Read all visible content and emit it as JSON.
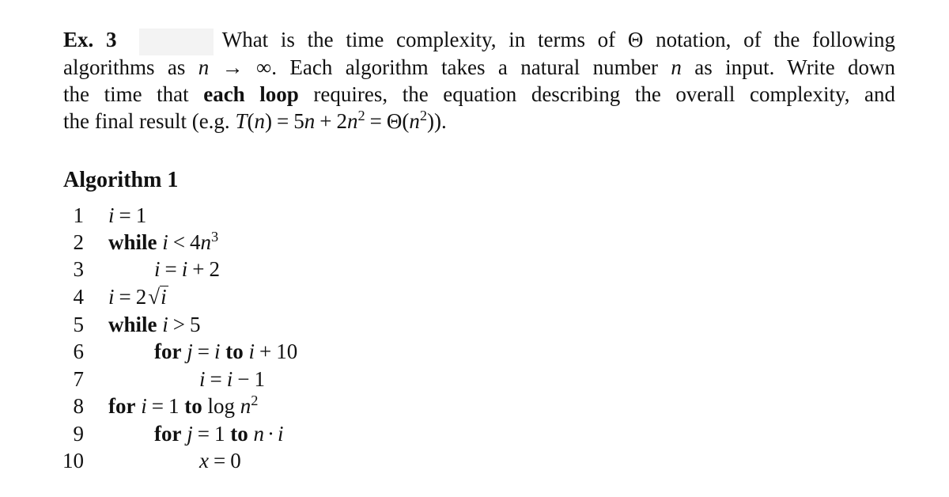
{
  "exercise": {
    "label": "Ex. 3",
    "redacted_box_color": "#f3f3f3",
    "paragraph": {
      "line1": {
        "text_a": "What is the time complexity, in terms of",
        "theta": "Θ",
        "text_b": "notation, of the following"
      },
      "line2": {
        "text_a": "algorithms as",
        "math_var": "n",
        "arrow": "→",
        "infinity": "∞.",
        "text_b": "Each algorithm takes a natural number",
        "math_var2": "n",
        "text_c": "as input.  Write down"
      },
      "line3": {
        "text_a": "the time that",
        "bold": "each loop",
        "text_b": "requires, the equation describing the overall complexity, and"
      },
      "line4": {
        "text_a": "the final result (e.g.",
        "formula_T": "T",
        "formula_paren_open": "(",
        "formula_n": "n",
        "formula_paren_close": ")",
        "eq1": "=",
        "term1_coef": "5",
        "term1_var": "n",
        "plus": "+",
        "term2_coef": "2",
        "term2_var": "n",
        "term2_exp": "2",
        "eq2": "=",
        "theta": "Θ(",
        "theta_var": "n",
        "theta_exp": "2",
        "closing": ")).",
        "full_text": "the final result (e.g. T(n) = 5n + 2n² = Θ(n²))."
      }
    }
  },
  "algorithm": {
    "title": "Algorithm 1",
    "lines": [
      {
        "number": "1",
        "text": "i = 1"
      },
      {
        "number": "2",
        "keyword": "while",
        "text": "i < 4n³"
      },
      {
        "number": "3",
        "text": "i = i + 2"
      },
      {
        "number": "4",
        "text": "i = 2√i"
      },
      {
        "number": "5",
        "keyword": "while",
        "text": "i > 5"
      },
      {
        "number": "6",
        "keyword": "for",
        "text": "j = i to i + 10"
      },
      {
        "number": "7",
        "text": "i = i − 1"
      },
      {
        "number": "8",
        "keyword": "for",
        "text": "i = 1 to log n²"
      },
      {
        "number": "9",
        "keyword": "for",
        "text": "j = 1 to n · i"
      },
      {
        "number": "10",
        "text": "x = 0"
      }
    ],
    "tokens": {
      "i": "i",
      "j": "j",
      "n": "n",
      "x": "x",
      "eq": "=",
      "lt": "<",
      "gt": ">",
      "plus": "+",
      "minus": "−",
      "cdot": "·",
      "one": "1",
      "two": "2",
      "three": "3",
      "four": "4",
      "five": "5",
      "ten": "10",
      "zero": "0",
      "while": "while",
      "for": "for",
      "to": "to",
      "log": "log",
      "sqrt_sign": "√"
    }
  }
}
